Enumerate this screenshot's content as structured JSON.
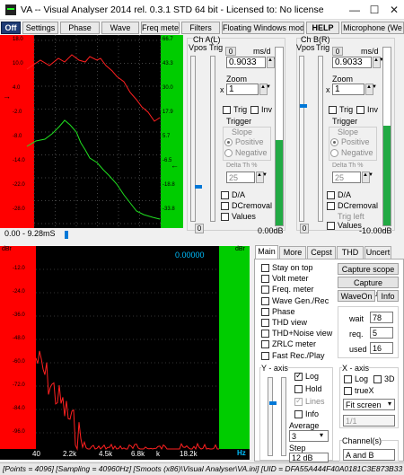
{
  "window": {
    "title": "VA -- Visual Analyser 2014 rel. 0.3.1 STD 64 bit - Licensed to: No license",
    "min": "—",
    "max": "☐",
    "close": "✕"
  },
  "toolbar": {
    "off": "Off",
    "settings": "Settings",
    "phase": "Phase",
    "wave": "Wave",
    "freq_meter": "Freq meter",
    "filters": "Filters",
    "floating": "Floating Windows mode",
    "help": "HELP",
    "microphone": "Microphone (We"
  },
  "scope": {
    "left_ticks": [
      "18.0",
      "10.0",
      "4.0",
      "-2.0",
      "-8.0",
      "-14.0",
      "-22.0",
      "-28.0"
    ],
    "right_ticks": [
      "66.7",
      "43.3",
      "30.0",
      "17.9",
      "5.7",
      "-6.5",
      "-18.8",
      "-33.8"
    ],
    "time_label": "0.00 - 9.28mS",
    "colors": {
      "ch_a": "#ff2020",
      "ch_b": "#20e020",
      "bg": "#000000"
    },
    "trace_a": [
      30,
      38,
      45,
      28,
      55,
      34,
      65,
      26,
      72,
      30,
      80,
      22,
      88,
      28,
      95,
      30,
      100,
      24,
      108,
      28,
      112,
      26,
      118,
      34,
      125,
      40,
      130,
      46,
      138,
      52,
      145,
      64,
      152,
      72,
      158,
      80,
      165,
      86,
      172,
      96,
      178,
      92
    ],
    "trace_b": [
      30,
      124,
      40,
      118,
      50,
      116,
      58,
      110,
      66,
      102,
      72,
      95,
      78,
      100,
      85,
      108,
      90,
      120,
      95,
      128,
      100,
      137,
      108,
      142,
      115,
      150,
      122,
      157,
      130,
      166,
      138,
      178,
      145,
      187,
      152,
      196,
      160,
      200,
      170,
      203,
      178,
      205
    ]
  },
  "ch_a": {
    "title": "Ch A(L)",
    "vpos": "Vpos",
    "trig": "Trig",
    "ms_label": "ms/d",
    "ms_value": "0.9033",
    "zoom_label": "Zoom",
    "zoom_value": "1",
    "x": "x",
    "trig_cb": "Trig",
    "inv_cb": "Inv",
    "trigger": "Trigger",
    "slope": "Slope",
    "positive": "Positive",
    "negative": "Negative",
    "delta": "Delta Th %",
    "delta_value": "25",
    "da": "D/A",
    "dcremoval": "DCremoval",
    "values": "Values",
    "zero": "0",
    "db": "0.00dB",
    "spin_zero": "0"
  },
  "ch_b": {
    "title": "Ch B(R)",
    "vpos": "Vpos",
    "trig": "Trig",
    "ms_label": "ms/d",
    "ms_value": "0.9033",
    "zoom_label": "Zoom",
    "zoom_value": "1",
    "x": "x",
    "trig_cb": "Trig",
    "inv_cb": "Inv",
    "trigger": "Trigger",
    "slope": "Slope",
    "positive": "Positive",
    "negative": "Negative",
    "delta": "Delta Th %",
    "delta_value": "25",
    "da": "D/A",
    "dcremoval": "DCremoval",
    "trig_left": "Trig left",
    "values": "Values",
    "zero": "0",
    "db": "-10.00dB",
    "spin_zero": "0"
  },
  "spectrum": {
    "left_label": "dBr",
    "right_label": "dBr",
    "readout": "0.00000",
    "db_ticks": [
      "-12.0",
      "-24.0",
      "-36.0",
      "-48.0",
      "-60.0",
      "-72.0",
      "-84.0",
      "-96.0"
    ],
    "freq_ticks": [
      "40",
      "2.2k",
      "4.5k",
      "6.8k",
      "k",
      "18.2k"
    ],
    "hz": "Hz",
    "colors": {
      "trace": "#ff2020",
      "bar_left": "#ff0000",
      "bar_right": "#00cc00"
    }
  },
  "tabs": [
    "Main",
    "More",
    "Cepst",
    "THD",
    "Uncert"
  ],
  "main": {
    "options": [
      {
        "label": "Stay on top",
        "checked": false
      },
      {
        "label": "Volt meter",
        "checked": false
      },
      {
        "label": "Freq. meter",
        "checked": false
      },
      {
        "label": "Wave Gen./Rec",
        "checked": false
      },
      {
        "label": "Phase",
        "checked": false
      },
      {
        "label": "THD view",
        "checked": false
      },
      {
        "label": "THD+Noise view",
        "checked": false
      },
      {
        "label": "ZRLC meter",
        "checked": false
      },
      {
        "label": "Fast Rec./Play",
        "checked": false
      }
    ],
    "capture_scope": "Capture scope",
    "capture_spectrum": "Capture spectrum",
    "waveon": "WaveOn",
    "info": "Info",
    "wait_label": "wait",
    "wait_value": "78",
    "req_label": "req.",
    "req_value": "5",
    "used_label": "used",
    "used_value": "16",
    "y_axis": "Y - axis",
    "log": "Log",
    "hold": "Hold",
    "lines": "Lines",
    "y_info": "Info",
    "average": "Average",
    "average_value": "3",
    "step": "Step",
    "step_value": "12 dB",
    "x_axis": "X - axis",
    "x_log": "Log",
    "x_3d": "3D",
    "truex": "trueX",
    "fit": "Fit screen",
    "ratio": "1/1",
    "channels": "Channel(s)",
    "channels_value": "A and B"
  },
  "status": {
    "text": "[Points = 4096]  [Sampling = 40960Hz]  [Smoots (x86)\\Visual Analyser\\VA.ini]  [UID = DFA55A444F40A0181C3E873B33"
  }
}
